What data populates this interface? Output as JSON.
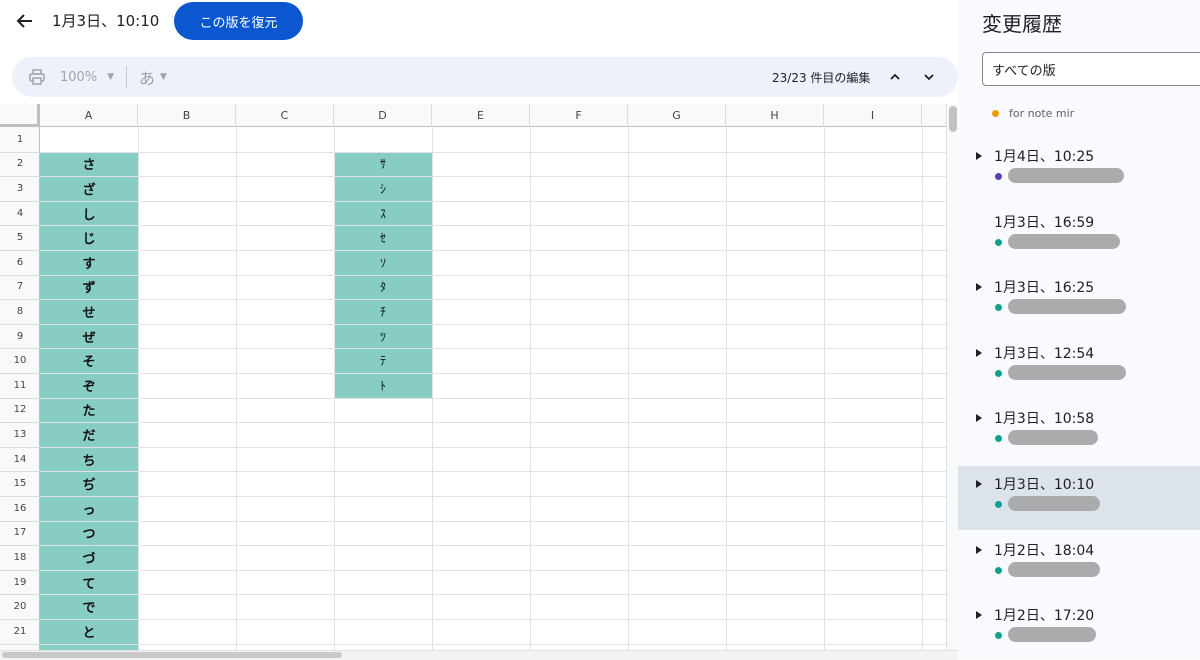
{
  "header": {
    "title": "1月3日、10:10",
    "restore_label": "この版を復元"
  },
  "toolbar": {
    "zoom": "100%",
    "input_char": "あ",
    "edits": "23/23 件目の編集"
  },
  "columns": [
    "A",
    "B",
    "C",
    "D",
    "E",
    "F",
    "G",
    "H",
    "I"
  ],
  "rows": 21,
  "partial_row": "22",
  "highlight_color": "#87cdc4",
  "col_a": [
    "さ",
    "ざ",
    "し",
    "じ",
    "す",
    "ず",
    "せ",
    "ぜ",
    "そ",
    "ぞ",
    "た",
    "だ",
    "ち",
    "ぢ",
    "っ",
    "つ",
    "づ",
    "て",
    "で",
    "と"
  ],
  "col_d": [
    "ｻ",
    "ｼ",
    "ｽ",
    "ｾ",
    "ｿ",
    "ﾀ",
    "ﾁ",
    "ﾂ",
    "ﾃ",
    "ﾄ"
  ],
  "panel": {
    "title": "変更履歴",
    "filter_value": "すべての版",
    "named_version": "for note mir",
    "versions": [
      {
        "date": "1月4日、10:25",
        "has_caret": true,
        "color": "#5e3fb0",
        "selected": false
      },
      {
        "date": "1月3日、16:59",
        "has_caret": false,
        "color": "#12a090",
        "selected": false
      },
      {
        "date": "1月3日、16:25",
        "has_caret": true,
        "color": "#12a090",
        "selected": false
      },
      {
        "date": "1月3日、12:54",
        "has_caret": true,
        "color": "#12a090",
        "selected": false
      },
      {
        "date": "1月3日、10:58",
        "has_caret": true,
        "color": "#12a090",
        "selected": false
      },
      {
        "date": "1月3日、10:10",
        "has_caret": true,
        "color": "#12a090",
        "selected": true
      },
      {
        "date": "1月2日、18:04",
        "has_caret": true,
        "color": "#12a090",
        "selected": false
      },
      {
        "date": "1月2日、17:20",
        "has_caret": true,
        "color": "#12a090",
        "selected": false
      }
    ]
  }
}
